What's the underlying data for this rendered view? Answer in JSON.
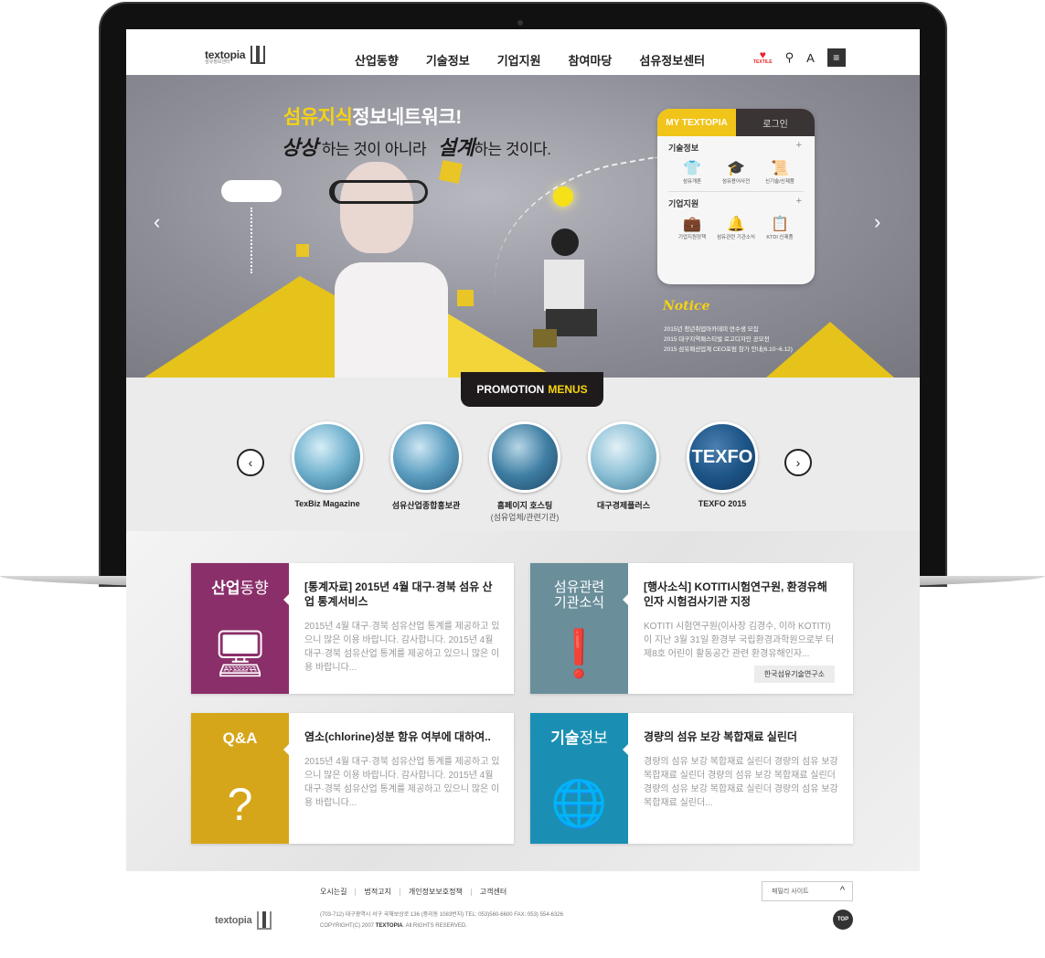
{
  "header": {
    "logo": "textopia",
    "logo_sub": "섬유정보센터",
    "nav": [
      "산업동향",
      "기술정보",
      "기업지원",
      "참여마당",
      "섬유정보센터"
    ],
    "textile_label": "TEXTILE",
    "search_icon": "search-icon",
    "font_icon": "A",
    "menu_icon": "≡"
  },
  "hero": {
    "title_highlight": "섬유지식",
    "title_rest": "정보네트워크!",
    "sub_1": "상상",
    "sub_2": "하는 것이 아니라",
    "sub_3": "설계",
    "sub_4": "하는 것이다."
  },
  "panel": {
    "tab_active": "MY TEXTOPIA",
    "tab_login": "로그인",
    "sections": [
      {
        "title": "기술정보",
        "items": [
          {
            "label": "섬유개론",
            "icon": "sweater-icon"
          },
          {
            "label": "섬유용어사전",
            "icon": "graduation-cap-icon"
          },
          {
            "label": "신기술/신제품",
            "icon": "certificate-icon"
          }
        ]
      },
      {
        "title": "기업지원",
        "items": [
          {
            "label": "기업지원정책",
            "icon": "briefcase-icon"
          },
          {
            "label": "섬유관련 기관소식",
            "icon": "bell-icon"
          },
          {
            "label": "KTDI 신제품",
            "icon": "ktdi-icon"
          }
        ]
      }
    ]
  },
  "notice": {
    "title": "Notice",
    "items": [
      "2015년 청년취업아카데미 연수생 모집",
      "2015 대구지역패스티벌 로고디자인 공모전",
      "2015 섬유패션업계 CEO포럼 참가 안내(6.10~6.12)"
    ]
  },
  "promotion": {
    "tag_1": "PROMOTION",
    "tag_2": "MENUS",
    "items": [
      {
        "name": "TexBiz Magazine",
        "sub": ""
      },
      {
        "name": "섬유산업종합홍보관",
        "sub": ""
      },
      {
        "name": "홈페이지 호스팅",
        "sub": "(섬유업체/관련기관)"
      },
      {
        "name": "대구경제플러스",
        "sub": ""
      },
      {
        "name": "TEXFO 2015",
        "sub": ""
      }
    ],
    "texfo_circle": "TEXFO"
  },
  "cards": [
    {
      "cat_bold": "산업",
      "cat_light": "동향",
      "title": "[통계자료] 2015년 4월 대구·경북 섬유 산업 통계서비스",
      "text": "2015년 4월 대구·경북 섬유산업 통계를 제공하고 있으니 많은 이용 바랍니다. 감사합니다. 2015년 4월 대구·경북 섬유산업 통계를 제공하고 있으니 많은 이용 바랍니다...",
      "badge": "",
      "color": "#8b2f6a"
    },
    {
      "cat_bold": "섬유관련",
      "cat_light": "기관소식",
      "title": "[행사소식] KOTITI시험연구원, 환경유해 인자 시험검사기관 지정",
      "text": "KOTITI 시험연구원(이사장 김경수, 이하 KOTITI) 이 지난 3월 31일 환경부 국립환경과학원으로부 터 제8호 어린이 활동공간 관련 환경유해인자...",
      "badge": "한국섬유기술연구소",
      "color": "#6a8f9b"
    },
    {
      "cat_bold": "Q&A",
      "cat_light": "",
      "title": "염소(chlorine)성분 함유 여부에 대하여..",
      "text": "2015년 4월 대구·경북 섬유산업 통계를 제공하고 있으니 많은 이용 바랍니다. 감사합니다. 2015년 4월 대구·경북 섬유산업 통계를 제공하고 있으니 많은 이용 바랍니다...",
      "badge": "",
      "color": "#d6a61a"
    },
    {
      "cat_bold": "기술",
      "cat_light": "정보",
      "title": "경량의 섬유 보강 복합재료 실린더",
      "text": "경량의 섬유 보강 복합재료 실린더 경량의 섬유 보강 복합재료 실린더 경량의 섬유 보강 복합재료 실린더 경량의 섬유 보강 복합재료 실린더 경량의 섬유 보강 복합재료 실린더...",
      "badge": "",
      "color": "#1b8fb3"
    }
  ],
  "footer": {
    "links": [
      "오시는길",
      "법적고지",
      "개인정보보호정책",
      "고객센터"
    ],
    "family_site": "패밀리 사이트",
    "logo": "textopia",
    "address": "(703-712) 대구광역시 서구 국채보상로 136 (중리동 1083번지)   TEL: 053)560-6600   FAX: 053) 554-6326",
    "copyright": "COPYRIGHT(C) 2007",
    "copyright_brand": "TEXTOPIA",
    "copyright_rest": ". All RIGHTS RESERVED.",
    "top": "TOP"
  },
  "colors": {
    "accent_yellow": "#f6d312",
    "dark": "#1f1b1c",
    "magenta": "#8b2f6a",
    "steel": "#6a8f9b",
    "gold": "#d6a61a",
    "blue": "#1b8fb3"
  }
}
